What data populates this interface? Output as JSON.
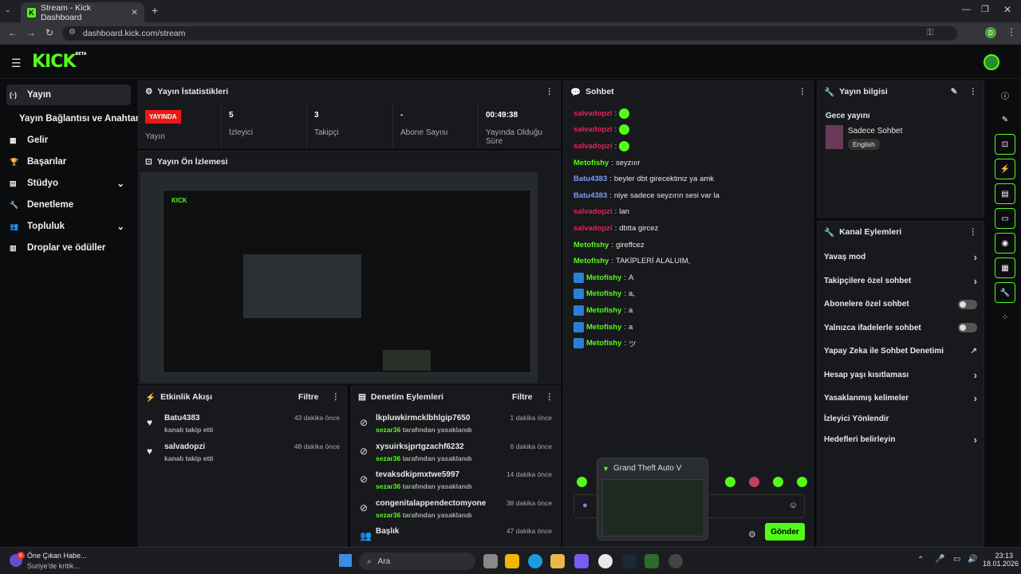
{
  "browser": {
    "tab_title": "Stream - Kick Dashboard",
    "url": "dashboard.kick.com/stream",
    "profile_letter": "D"
  },
  "brand": {
    "logo": "KICK",
    "beta": "BETA",
    "accent": "#53fc18"
  },
  "sidebar": {
    "items": [
      {
        "label": "Yayın",
        "icon": "broadcast-icon"
      },
      {
        "label": "Yayın Bağlantısı ve Anahtarı",
        "icon": ""
      },
      {
        "label": "Gelir",
        "icon": "chart-icon"
      },
      {
        "label": "Başarılar",
        "icon": "trophy-icon"
      },
      {
        "label": "Stüdyo",
        "icon": "studio-icon"
      },
      {
        "label": "Denetleme",
        "icon": "wrench-icon"
      },
      {
        "label": "Topluluk",
        "icon": "people-icon"
      },
      {
        "label": "Droplar ve ödüller",
        "icon": "gift-icon"
      }
    ]
  },
  "stats": {
    "title": "Yayın İstatistikleri",
    "live_badge": "YAYINDA",
    "live_label": "Yayın",
    "cells": [
      {
        "value": "5",
        "label": "İzleyici"
      },
      {
        "value": "3",
        "label": "Takipçi"
      },
      {
        "value": "-",
        "label": "Abone Sayısı"
      },
      {
        "value": "00:49:38",
        "label": "Yayında Olduğu Süre"
      }
    ]
  },
  "preview": {
    "title": "Yayın Ön İzlemesi"
  },
  "activity": {
    "title": "Etkinlik Akışı",
    "filter": "Filtre",
    "items": [
      {
        "user": "Batu4383",
        "action": "kanalı takip etti",
        "time": "43 dakika önce"
      },
      {
        "user": "salvadopzi",
        "action": "kanalı takip etti",
        "time": "48 dakika önce"
      }
    ]
  },
  "moderation": {
    "title": "Denetim Eylemleri",
    "filter": "Filtre",
    "items": [
      {
        "user": "lkpluwkirmcklbhlgip7650",
        "mod": "sezar36",
        "action": "tarafından yasaklandı",
        "time": "1 dakika önce"
      },
      {
        "user": "xysuirksjprtgzachf6232",
        "mod": "sezar36",
        "action": "tarafından yasaklandı",
        "time": "6 dakika önce"
      },
      {
        "user": "tevaksdkipmxtwe5997",
        "mod": "sezar36",
        "action": "tarafından yasaklandı",
        "time": "14 dakika önce"
      },
      {
        "user": "congenitalappendectomyone",
        "mod": "sezar36",
        "action": "tarafından yasaklandı",
        "time": "38 dakika önce"
      },
      {
        "user": "Başlık",
        "mod": "",
        "action": "",
        "time": "47 dakika önce"
      }
    ]
  },
  "chat": {
    "title": "Sohbet",
    "send": "Gönder",
    "messages": [
      {
        "user": "salvadopzi",
        "cls": "u-red",
        "text": "",
        "emote": true,
        "badge": false
      },
      {
        "user": "salvadopzi",
        "cls": "u-red",
        "text": "",
        "emote": true,
        "badge": false
      },
      {
        "user": "salvadopzi",
        "cls": "u-red",
        "text": "",
        "emote": true,
        "badge": false
      },
      {
        "user": "Metofishy",
        "cls": "u-green",
        "text": "seyzııır",
        "emote": false,
        "badge": false
      },
      {
        "user": "Batu4383",
        "cls": "u-blue",
        "text": "beyler dbt girecektiniz ya amk",
        "emote": false,
        "badge": false
      },
      {
        "user": "Batu4383",
        "cls": "u-blue",
        "text": "niye sadece seyzırın sesi var la",
        "emote": false,
        "badge": false
      },
      {
        "user": "salvadopzi",
        "cls": "u-red",
        "text": "lan",
        "emote": false,
        "badge": false
      },
      {
        "user": "salvadopzi",
        "cls": "u-red",
        "text": "dbtta gircez",
        "emote": false,
        "badge": false
      },
      {
        "user": "Metofishy",
        "cls": "u-green",
        "text": "gireffcez",
        "emote": false,
        "badge": false
      },
      {
        "user": "Metofishy",
        "cls": "u-green",
        "text": "TAKİPLERİ ALALUIM,",
        "emote": false,
        "badge": false
      },
      {
        "user": "Metofishy",
        "cls": "u-green",
        "text": "A",
        "emote": false,
        "badge": true
      },
      {
        "user": "Metofishy",
        "cls": "u-green",
        "text": "a,",
        "emote": false,
        "badge": true
      },
      {
        "user": "Metofishy",
        "cls": "u-green",
        "text": "a",
        "emote": false,
        "badge": true
      },
      {
        "user": "Metofishy",
        "cls": "u-green",
        "text": "a",
        "emote": false,
        "badge": true
      },
      {
        "user": "Metofishy",
        "cls": "u-green",
        "text": "ツ",
        "emote": false,
        "badge": true
      }
    ]
  },
  "popup": {
    "title": "Grand Theft Auto V"
  },
  "info": {
    "title": "Yayın bilgisi",
    "stream_title": "Gece yayını",
    "category": "Sadece Sohbet",
    "language": "English"
  },
  "channel": {
    "title": "Kanal Eylemleri",
    "actions": [
      {
        "label": "Yavaş mod",
        "kind": "chevron"
      },
      {
        "label": "Takipçilere özel sohbet",
        "kind": "chevron"
      },
      {
        "label": "Abonelere özel sohbet",
        "kind": "toggle"
      },
      {
        "label": "Yalnızca ifadelerle sohbet",
        "kind": "toggle"
      },
      {
        "label": "Yapay Zeka ile Sohbet Denetimi",
        "kind": "external"
      },
      {
        "label": "Hesap yaşı kısıtlaması",
        "kind": "chevron"
      },
      {
        "label": "Yasaklanmış kelimeler",
        "kind": "chevron"
      },
      {
        "label": "İzleyici Yönlendir",
        "kind": "none"
      },
      {
        "label": "Hedefleri belirleyin",
        "kind": "chevron"
      }
    ]
  },
  "taskbar": {
    "news_title": "Öne Çıkan Habe...",
    "news_sub": "Suriye'de kritik...",
    "news_count": "6",
    "search": "Ara",
    "time": "23:13",
    "date": "18.01.2026"
  }
}
